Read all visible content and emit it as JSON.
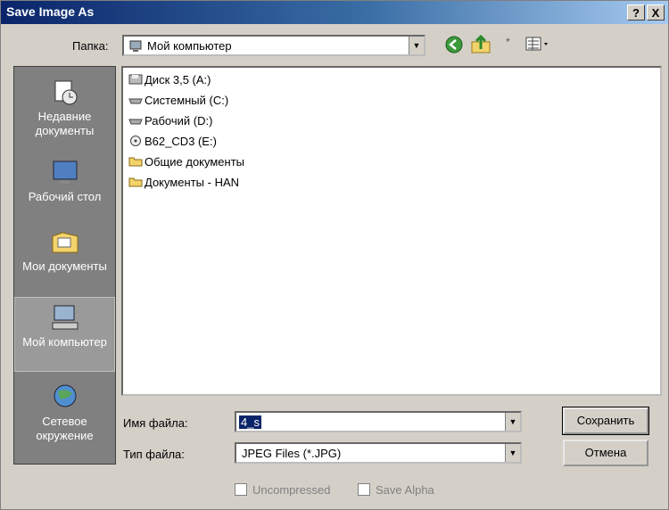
{
  "window": {
    "title": "Save Image As",
    "help_button": "?",
    "close_button": "X"
  },
  "folder": {
    "label": "Папка:",
    "selected": "Мой компьютер"
  },
  "places": [
    {
      "label": "Недавние документы"
    },
    {
      "label": "Рабочий стол"
    },
    {
      "label": "Мои документы"
    },
    {
      "label": "Мой компьютер"
    },
    {
      "label": "Сетевое окружение"
    }
  ],
  "files": [
    {
      "name": "Диск 3,5 (A:)",
      "icon": "floppy-drive-icon"
    },
    {
      "name": "Системный (C:)",
      "icon": "hard-drive-icon"
    },
    {
      "name": "Рабочий (D:)",
      "icon": "hard-drive-icon"
    },
    {
      "name": "B62_CD3 (E:)",
      "icon": "cd-drive-icon"
    },
    {
      "name": "Общие документы",
      "icon": "folder-icon"
    },
    {
      "name": "Документы - HAN",
      "icon": "folder-icon"
    }
  ],
  "filename": {
    "label": "Имя файла:",
    "value": "4_s"
  },
  "filetype": {
    "label": "Тип файла:",
    "value": "JPEG Files (*.JPG)"
  },
  "buttons": {
    "save": "Сохранить",
    "cancel": "Отмена"
  },
  "options": {
    "uncompressed": "Uncompressed",
    "save_alpha": "Save Alpha"
  },
  "colors": {
    "title_start": "#0a246a",
    "title_end": "#a6caf0",
    "places_bg": "#808080",
    "folder_yellow": "#f3d36b"
  }
}
